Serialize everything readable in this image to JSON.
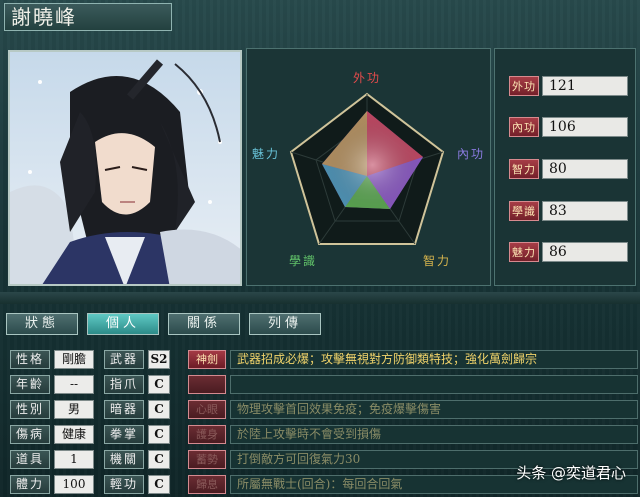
{
  "name": "謝曉峰",
  "radar": {
    "labels": [
      "外功",
      "內功",
      "智力",
      "學識",
      "魅力"
    ]
  },
  "stats": [
    {
      "label": "外功",
      "value": "121"
    },
    {
      "label": "內功",
      "value": "106"
    },
    {
      "label": "智力",
      "value": "80"
    },
    {
      "label": "學識",
      "value": "83"
    },
    {
      "label": "魅力",
      "value": "86"
    }
  ],
  "tabs": [
    "狀態",
    "個人",
    "關係",
    "列傳"
  ],
  "attributes": [
    {
      "label": "性格",
      "value": "剛膽"
    },
    {
      "label": "年齡",
      "value": "--"
    },
    {
      "label": "性別",
      "value": "男"
    },
    {
      "label": "傷病",
      "value": "健康"
    },
    {
      "label": "道具",
      "value": "1"
    },
    {
      "label": "體力",
      "value": "100"
    }
  ],
  "weapons": [
    {
      "label": "武器",
      "value": "S2"
    },
    {
      "label": "指爪",
      "value": "C"
    },
    {
      "label": "暗器",
      "value": "C"
    },
    {
      "label": "拳掌",
      "value": "C"
    },
    {
      "label": "機關",
      "value": "C"
    },
    {
      "label": "輕功",
      "value": "C"
    }
  ],
  "skills": [
    {
      "label": "神劍",
      "desc": "武器招成必爆；攻擊無視對方防御類特技；強化萬劍歸宗"
    },
    {
      "label": "",
      "desc": ""
    },
    {
      "label": "心眼",
      "desc": "物理攻擊首回效果免疫；免疫爆擊傷害"
    },
    {
      "label": "護身",
      "desc": "於陸上攻擊時不會受到損傷"
    },
    {
      "label": "蓄勢",
      "desc": "打倒敵方可回復氣力30"
    },
    {
      "label": "歸息",
      "desc": "所屬無戰士(回合)：每回合回氣"
    }
  ],
  "watermark": "头条 @奕道君心"
}
